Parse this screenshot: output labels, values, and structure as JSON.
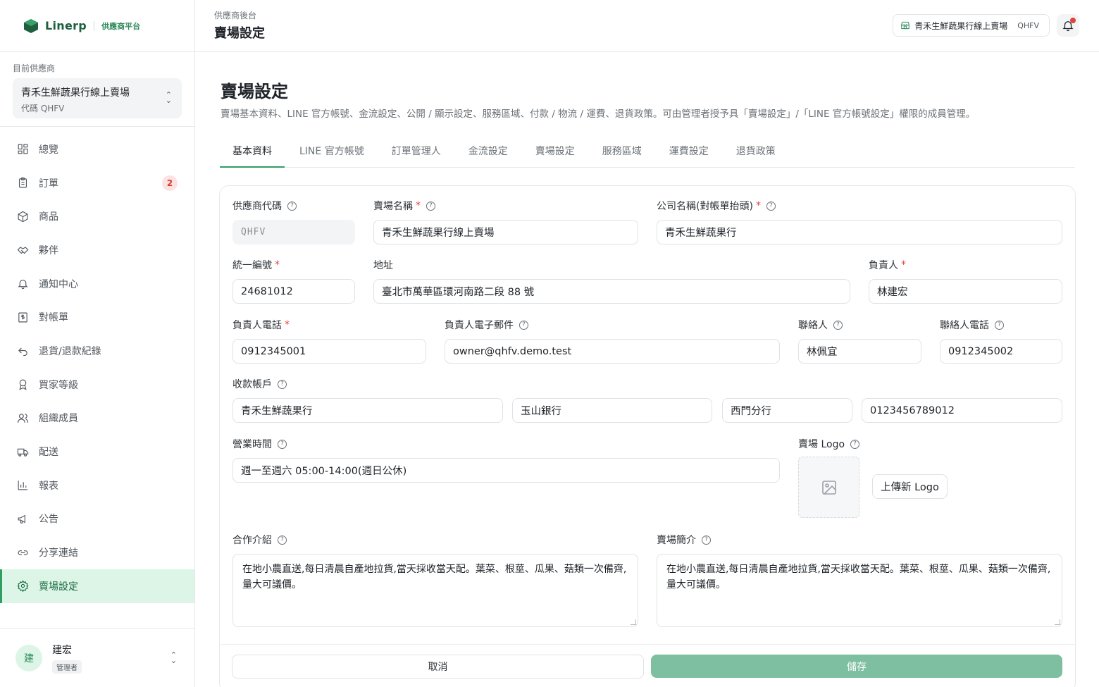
{
  "brand": {
    "name": "Linerp",
    "subtitle": "供應商平台"
  },
  "vendor": {
    "caption": "目前供應商",
    "name": "青禾生鮮蔬果行線上賣場",
    "code": "代碼 QHFV"
  },
  "nav": [
    {
      "label": "總覽",
      "icon": "dashboard-icon"
    },
    {
      "label": "訂單",
      "icon": "clipboard-icon",
      "badge": "2"
    },
    {
      "label": "商品",
      "icon": "box-icon"
    },
    {
      "label": "夥伴",
      "icon": "handshake-icon"
    },
    {
      "label": "通知中心",
      "icon": "bell-icon"
    },
    {
      "label": "對帳單",
      "icon": "invoice-icon"
    },
    {
      "label": "退貨/退款紀錄",
      "icon": "return-icon"
    },
    {
      "label": "買家等級",
      "icon": "medal-icon"
    },
    {
      "label": "組織成員",
      "icon": "users-icon"
    },
    {
      "label": "配送",
      "icon": "truck-icon"
    },
    {
      "label": "報表",
      "icon": "bar-chart-icon"
    },
    {
      "label": "公告",
      "icon": "megaphone-icon"
    },
    {
      "label": "分享連結",
      "icon": "link-icon"
    },
    {
      "label": "賣場設定",
      "icon": "gear-icon",
      "active": true
    }
  ],
  "user": {
    "avatar": "建",
    "name": "建宏",
    "role": "管理者"
  },
  "header": {
    "breadcrumb": "供應商後台",
    "title": "賣場設定",
    "store_name": "青禾生鮮蔬果行線上賣場",
    "store_code": "QHFV"
  },
  "page": {
    "title": "賣場設定",
    "description": "賣場基本資料、LINE 官方帳號、金流設定、公開 / 顯示設定、服務區域、付款 / 物流 / 運費、退貨政策。可由管理者授予具「賣場設定」/「LINE 官方帳號設定」權限的成員管理。",
    "tabs": [
      "基本資料",
      "LINE 官方帳號",
      "訂單管理人",
      "金流設定",
      "賣場設定",
      "服務區域",
      "運費設定",
      "退貨政策"
    ]
  },
  "form": {
    "vendor_code": {
      "label": "供應商代碼",
      "value": "QHFV"
    },
    "store_name": {
      "label": "賣場名稱",
      "value": "青禾生鮮蔬果行線上賣場"
    },
    "company_name": {
      "label": "公司名稱(對帳單抬頭)",
      "value": "青禾生鮮蔬果行"
    },
    "tax_id": {
      "label": "統一編號",
      "value": "24681012"
    },
    "address": {
      "label": "地址",
      "value": "臺北市萬華區環河南路二段 88 號"
    },
    "owner": {
      "label": "負責人",
      "value": "林建宏"
    },
    "owner_phone": {
      "label": "負責人電話",
      "value": "0912345001"
    },
    "owner_email": {
      "label": "負責人電子郵件",
      "value": "owner@qhfv.demo.test"
    },
    "contact": {
      "label": "聯絡人",
      "value": "林佩宜"
    },
    "contact_phone": {
      "label": "聯絡人電話",
      "value": "0912345002"
    },
    "bank": {
      "label": "收款帳戶",
      "account_name": "青禾生鮮蔬果行",
      "bank_name": "玉山銀行",
      "branch": "西門分行",
      "account_no": "0123456789012"
    },
    "hours": {
      "label": "營業時間",
      "value": "週一至週六 05:00-14:00(週日公休)"
    },
    "logo": {
      "label": "賣場 Logo",
      "upload_label": "上傳新 Logo"
    },
    "cooperation": {
      "label": "合作介紹",
      "value": "在地小農直送,每日清晨自產地拉貨,當天採收當天配。葉菜、根莖、瓜果、菇類一次備齊,量大可議價。"
    },
    "intro": {
      "label": "賣場簡介",
      "value": "在地小農直送,每日清晨自產地拉貨,當天採收當天配。葉菜、根莖、瓜果、菇類一次備齊,量大可議價。"
    }
  },
  "actions": {
    "cancel": "取消",
    "save": "儲存"
  },
  "colors": {
    "accent": "#2f9e63",
    "save_button": "#7dbfa0",
    "active_nav_bg": "#dcf5e7",
    "badge": "#d63a3a"
  }
}
